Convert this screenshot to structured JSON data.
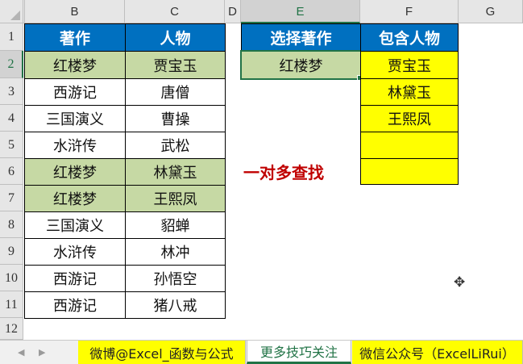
{
  "columns": [
    "B",
    "C",
    "D",
    "E",
    "F",
    "G"
  ],
  "rows": [
    "1",
    "2",
    "3",
    "4",
    "5",
    "6",
    "7",
    "8",
    "9",
    "10",
    "11",
    "12"
  ],
  "table_left": {
    "headers": [
      "著作",
      "人物"
    ],
    "rows": [
      [
        "红楼梦",
        "贾宝玉"
      ],
      [
        "西游记",
        "唐僧"
      ],
      [
        "三国演义",
        "曹操"
      ],
      [
        "水浒传",
        "武松"
      ],
      [
        "红楼梦",
        "林黛玉"
      ],
      [
        "红楼梦",
        "王熙凤"
      ],
      [
        "三国演义",
        "貂蝉"
      ],
      [
        "水浒传",
        "林冲"
      ],
      [
        "西游记",
        "孙悟空"
      ],
      [
        "西游记",
        "猪八戒"
      ]
    ],
    "highlighted_rows": [
      0,
      4,
      5
    ]
  },
  "lookup": {
    "header": "选择著作",
    "value": "红楼梦"
  },
  "result": {
    "header": "包含人物",
    "values": [
      "贾宝玉",
      "林黛玉",
      "王熙凤",
      "",
      ""
    ]
  },
  "annotation": "一对多查找",
  "selected_cell": "E2",
  "sheet_tabs": [
    "微博@Excel_函数与公式",
    "更多技巧关注",
    "微信公众号（ExcelLiRui）"
  ],
  "active_tab_index": 1,
  "colors": {
    "header_blue": "#0070c0",
    "highlight_green": "#c6d9a4",
    "result_yellow": "#ffff00",
    "note_red": "#c00000",
    "excel_green": "#217346"
  }
}
